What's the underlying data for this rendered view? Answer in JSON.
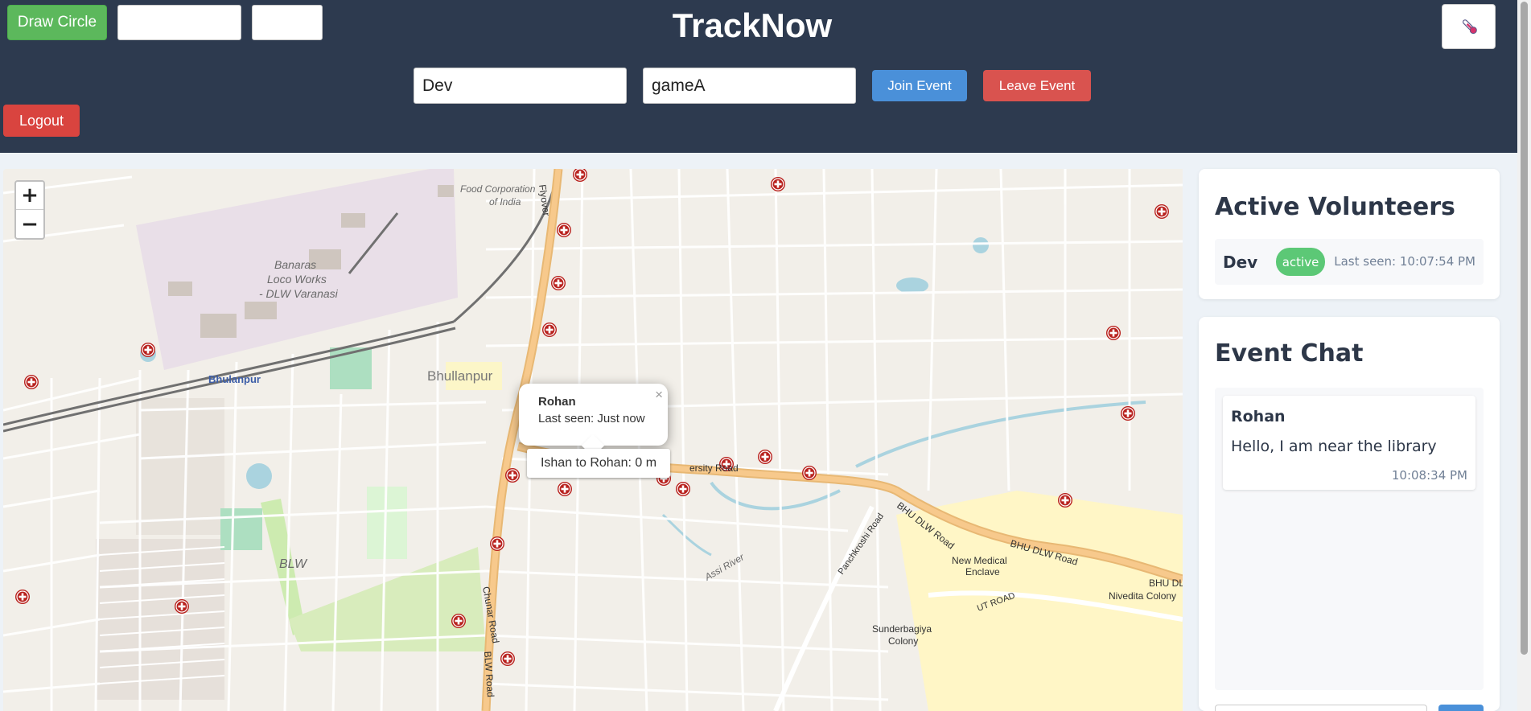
{
  "app": {
    "title": "TrackNow"
  },
  "header": {
    "draw_circle_label": "Draw Circle",
    "name_value": "Dev",
    "event_value": "gameA",
    "join_label": "Join Event",
    "leave_label": "Leave Event",
    "logout_label": "Logout",
    "tool_icon": "thermometer-icon"
  },
  "map": {
    "zoom_in": "+",
    "zoom_out": "−",
    "popup": {
      "name": "Rohan",
      "last_seen": "Last seen: Just now",
      "close": "×"
    },
    "distance_tooltip": "Ishan to Rohan: 0 m",
    "place_labels": {
      "food_corp": "Food Corporation",
      "of_india": "of India",
      "flyover": "Flyover",
      "banaras": "Banaras",
      "loco_works": "Loco Works",
      "dlw_varanasi": "- DLW Varanasi",
      "bhulanpur": "Bhulanpur",
      "bhullanpur": "Bhullanpur",
      "blw": "BLW",
      "university_road": "ersity Road",
      "panchkroshi": "Panchkroshi Road",
      "bhu_dlw_road": "BHU DLW Road",
      "bhu_dlw_road2": "BHU DLW Road",
      "bhu_dl": "BHU DL",
      "new_medical": "New Medical",
      "enclave": "Enclave",
      "nivedita": "Nivedita Colony",
      "ut_road": "UT ROAD",
      "sunderbagiya": "Sunderbagiya",
      "colony": "Colony",
      "assi_river": "Assi River",
      "chunar_road": "Chunar Road",
      "blw_road": "BLW Road"
    },
    "marker_icon": "hospital-marker-icon"
  },
  "volunteers": {
    "title": "Active Volunteers",
    "items": [
      {
        "name": "Dev",
        "status": "active",
        "last_seen": "Last seen: 10:07:54 PM"
      }
    ]
  },
  "chat": {
    "title": "Event Chat",
    "messages": [
      {
        "user": "Rohan",
        "text": "Hello, I am near the library",
        "time": "10:08:34 PM"
      }
    ]
  },
  "colors": {
    "header_bg": "#2d3a4f",
    "draw_btn": "#5cb85c",
    "join_btn": "#4a90d9",
    "leave_btn": "#d9534f",
    "logout_btn": "#d9443f",
    "active_badge": "#5cc876",
    "main_road": "#f7c98c",
    "marker": "#b8211d"
  }
}
